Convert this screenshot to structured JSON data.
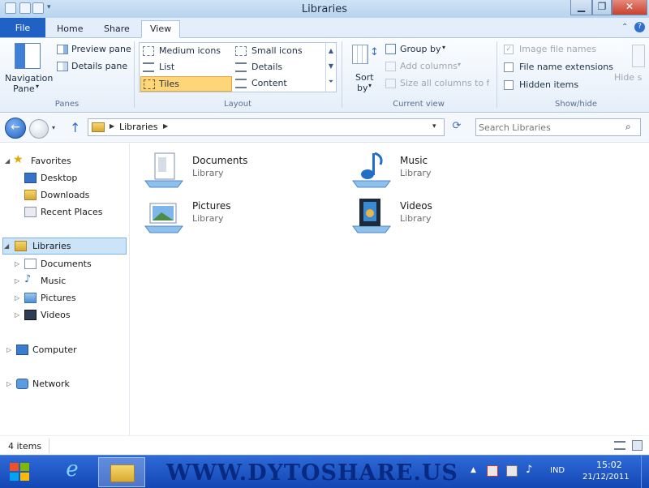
{
  "window": {
    "title": "Libraries"
  },
  "tabs": [
    {
      "label": "File"
    },
    {
      "label": "Home"
    },
    {
      "label": "Share"
    },
    {
      "label": "View"
    }
  ],
  "ribbon": {
    "panes": {
      "navigation_pane_line1": "Navigation",
      "navigation_pane_line2": "Pane",
      "preview_pane": "Preview pane",
      "details_pane": "Details pane",
      "group_label": "Panes"
    },
    "layout": {
      "items": [
        "Medium icons",
        "Small icons",
        "List",
        "Details",
        "Tiles",
        "Content"
      ],
      "selected": "Tiles",
      "group_label": "Layout"
    },
    "current_view": {
      "sort_line1": "Sort",
      "sort_line2": "by",
      "group_by": "Group by",
      "add_columns": "Add columns",
      "size_columns": "Size all columns to fit",
      "group_label": "Current view"
    },
    "show_hide": {
      "image_file_names": "Image file names",
      "file_name_extensions": "File name extensions",
      "hidden_items": "Hidden items",
      "hide_selected": "Hide s",
      "group_label": "Show/hide"
    }
  },
  "address": {
    "crumb": "Libraries",
    "search_placeholder": "Search Libraries"
  },
  "nav": {
    "favorites": "Favorites",
    "fav_items": [
      "Desktop",
      "Downloads",
      "Recent Places"
    ],
    "libraries": "Libraries",
    "lib_items": [
      "Documents",
      "Music",
      "Pictures",
      "Videos"
    ],
    "computer": "Computer",
    "network": "Network"
  },
  "content": {
    "tiles": [
      {
        "name": "Documents",
        "sub": "Library"
      },
      {
        "name": "Music",
        "sub": "Library"
      },
      {
        "name": "Pictures",
        "sub": "Library"
      },
      {
        "name": "Videos",
        "sub": "Library"
      }
    ]
  },
  "status": {
    "count": "4 items"
  },
  "taskbar": {
    "watermark": "WWW.DYTOSHARE.US",
    "lang": "IND",
    "time": "15:02",
    "date": "21/12/2011"
  },
  "colors": {
    "file_tab": "#1f62c3",
    "taskbar": "#1b52c4",
    "selected_layout": "#ffd57a"
  }
}
